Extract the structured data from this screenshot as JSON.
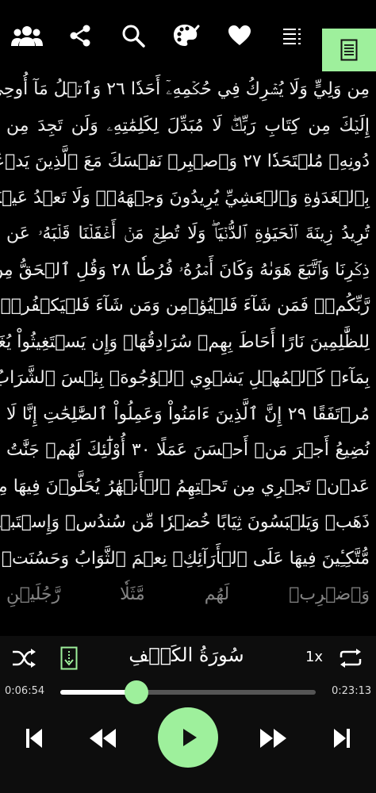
{
  "toolbar": {
    "items": [
      "groups-icon",
      "share-icon",
      "search-icon",
      "palette-icon",
      "heart-icon",
      "list-icon",
      "page-icon"
    ],
    "active_color": "#9ef09c"
  },
  "page": {
    "lines": [
      "مِن وَلِيٍّ وَلَا يُشۡرِكُ فِي حُكۡمِهِۦٓ أَحَدٗا ٢٦ وَٱتۡلُ مَآ أُوحِيَ",
      "إِلَيۡكَ مِن كِتَابِ رَبِّكَۖ لَا مُبَدِّلَ لِكَلِمَٰتِهِۦ وَلَن تَجِدَ مِن",
      "دُونِهِۦ مُلۡتَحَدٗا ٢٧ وَٱصۡبِرۡ نَفۡسَكَ مَعَ ٱلَّذِينَ يَدۡعُونَ رَبَّهُم",
      "بِٱلۡغَدَوٰةِ وَٱلۡعَشِيِّ يُرِيدُونَ وَجۡهَهُۥۖ وَلَا تَعۡدُ عَيۡنَاكَ عَنۡهُمۡ",
      "تُرِيدُ زِينَةَ ٱلۡحَيَوٰةِ ٱلدُّنۡيَاۖ وَلَا تُطِعۡ مَنۡ أَغۡفَلۡنَا قَلۡبَهُۥ عَن",
      "ذِكۡرِنَا وَٱتَّبَعَ هَوَىٰهُ وَكَانَ أَمۡرُهُۥ فُرُطٗا ٢٨ وَقُلِ ٱلۡحَقُّ مِن",
      "رَّبِّكُمۡۖ فَمَن شَآءَ فَلۡيُؤۡمِن وَمَن شَآءَ فَلۡيَكۡفُرۡۚ إِنَّآ أَعۡتَدۡنَا",
      "لِلظَّٰلِمِينَ نَارًا أَحَاطَ بِهِمۡ سُرَادِقُهَاۚ وَإِن يَسۡتَغِيثُواْ يُغَاثُواْ",
      "بِمَآءٖ كَٱلۡمُهۡلِ يَشۡوِي ٱلۡوُجُوهَۚ بِئۡسَ ٱلشَّرَابُ وَسَآءَتۡ",
      "مُرۡتَفَقًا ٢٩ إِنَّ ٱلَّذِينَ ءَامَنُواْ وَعَمِلُواْ ٱلصَّٰلِحَٰتِ إِنَّا لَا",
      "نُضِيعُ أَجۡرَ مَنۡ أَحۡسَنَ عَمَلًا ٣٠ أُوْلَٰٓئِكَ لَهُمۡ جَنَّٰتُ",
      "عَدۡنٖ تَجۡرِي مِن تَحۡتِهِمُ ٱلۡأَنۡهَٰرُ يُحَلَّوۡنَ فِيهَا مِنۡ أَسَاوِرَ مِن",
      "ذَهَبٖ وَيَلۡبَسُونَ ثِيَابًا خُضۡرٗا مِّن سُندُسٖ وَإِسۡتَبۡرَقٖ",
      "مُّتَّكِـِٔينَ فِيهَا عَلَى ٱلۡأَرَآئِكِۚ نِعۡمَ ٱلثَّوَابُ وَحَسُنَتۡ مُرۡتَفَقٗا",
      "وَٱضۡرِبۡ لَهُم مَّثَلٗا رَّجُلَيۡنِ"
    ]
  },
  "player": {
    "surah_name": "سُورَةُ الكَهۡفِ",
    "speed": "1x",
    "elapsed": "0:06:54",
    "total": "0:23:13",
    "progress": 0.297,
    "accent": "#9ef09c"
  }
}
